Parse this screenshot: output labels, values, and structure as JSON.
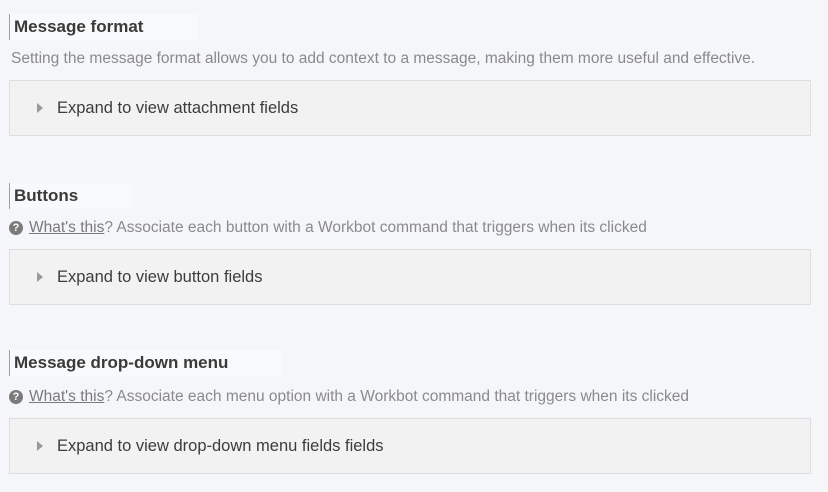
{
  "sections": [
    {
      "title": "Message format",
      "description": "Setting the message format allows you to add context to a message, making them more useful and effective.",
      "expander_label": "Expand to view attachment fields"
    },
    {
      "title": "Buttons",
      "help_link": "What's this",
      "help_text": "? Associate each button with a Workbot command that triggers when its clicked",
      "expander_label": "Expand to view button fields"
    },
    {
      "title": "Message drop-down menu",
      "help_link": "What's this",
      "help_text": "? Associate each menu option with a Workbot command that triggers when its clicked",
      "expander_label": "Expand to view drop-down menu fields fields"
    }
  ],
  "icons": {
    "help": "question-circle-icon",
    "caret": "caret-right-icon"
  }
}
